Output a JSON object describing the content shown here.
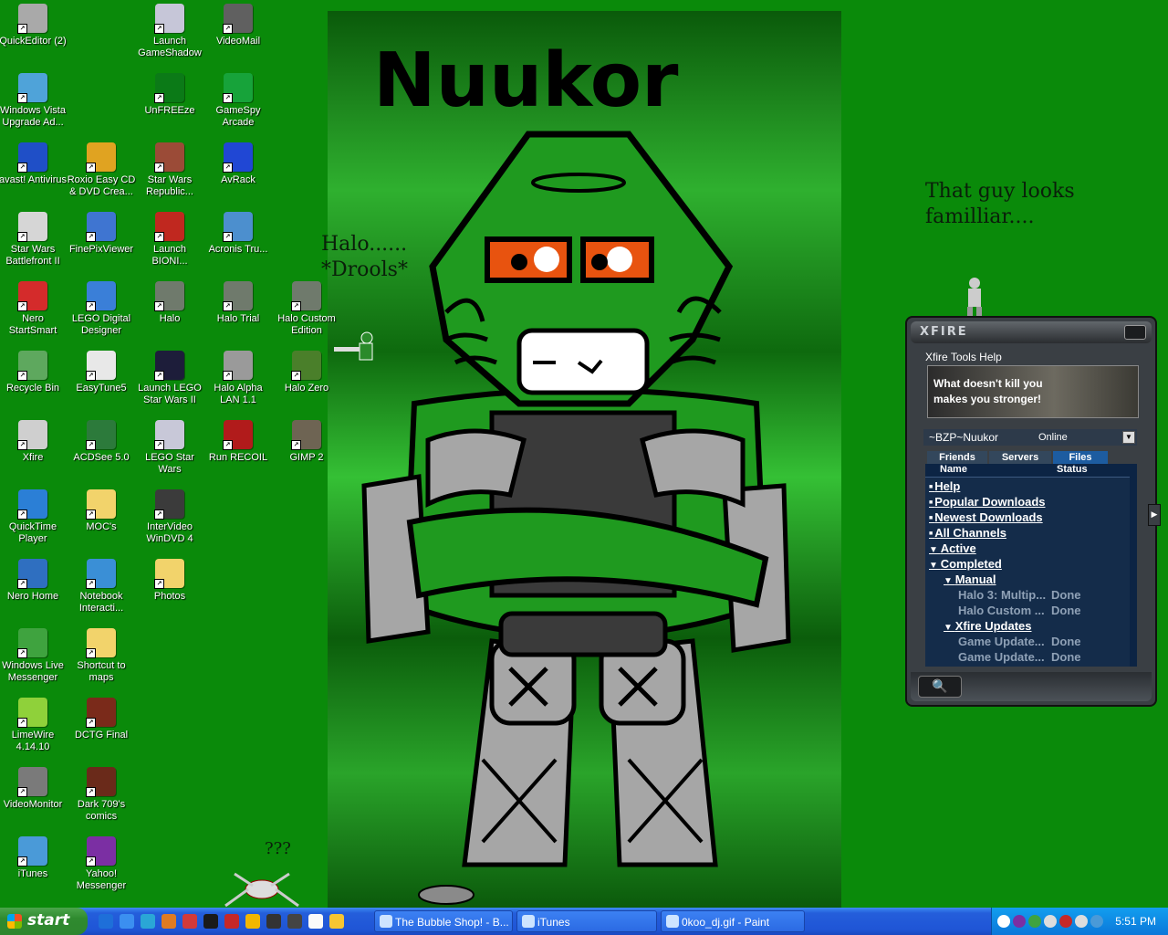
{
  "desktop_icons": [
    {
      "label": "QuickEditor (2)",
      "icon": "editor-icon",
      "color": "#a9a9a9"
    },
    {
      "label": "Launch GameShadow",
      "icon": "gameshadow-icon",
      "color": "#c6c6d8"
    },
    {
      "label": "VideoMail",
      "icon": "videomail-icon",
      "color": "#606060"
    },
    {
      "label": "Windows Vista Upgrade Ad...",
      "icon": "vista-icon",
      "color": "#4fa3d9"
    },
    {
      "label": "UnFREEze",
      "icon": "unfreeze-icon",
      "color": "#0b7a17"
    },
    {
      "label": "GameSpy Arcade",
      "icon": "gamespy-icon",
      "color": "#17a33a"
    },
    {
      "label": "avast! Antivirus",
      "icon": "avast-icon",
      "color": "#1f4fc7"
    },
    {
      "label": "Roxio Easy CD & DVD Crea...",
      "icon": "roxio-icon",
      "color": "#e0a321"
    },
    {
      "label": "Star Wars Republic...",
      "icon": "starwars-republic-icon",
      "color": "#9b4b37"
    },
    {
      "label": "AvRack",
      "icon": "avrack-icon",
      "color": "#2047d4"
    },
    {
      "label": "Star Wars Battlefront II",
      "icon": "battlefront-icon",
      "color": "#d6d6d6"
    },
    {
      "label": "FinePixViewer",
      "icon": "finepix-icon",
      "color": "#3f75d1"
    },
    {
      "label": "Launch BIONI...",
      "icon": "bionicle-icon",
      "color": "#c0281f"
    },
    {
      "label": "Acronis Tru...",
      "icon": "acronis-icon",
      "color": "#4c8fce"
    },
    {
      "label": "Nero StartSmart",
      "icon": "nero-icon",
      "color": "#d42b2b"
    },
    {
      "label": "LEGO Digital Designer",
      "icon": "lego-designer-icon",
      "color": "#3a7fd8"
    },
    {
      "label": "Halo",
      "icon": "halo-icon",
      "color": "#6f7a6c"
    },
    {
      "label": "Halo Trial",
      "icon": "halo-trial-icon",
      "color": "#6f7a6c"
    },
    {
      "label": "Halo Custom Edition",
      "icon": "halo-custom-icon",
      "color": "#6f7a6c"
    },
    {
      "label": "Recycle Bin",
      "icon": "recycle-bin-icon",
      "color": "#5ea85e"
    },
    {
      "label": "EasyTune5",
      "icon": "easytune-icon",
      "color": "#e8e8e8"
    },
    {
      "label": "Launch LEGO Star Wars II",
      "icon": "lego-starwars-icon",
      "color": "#1d1d3a"
    },
    {
      "label": "Halo Alpha LAN 1.1",
      "icon": "halo-alpha-icon",
      "color": "#9a9a9a"
    },
    {
      "label": "Halo Zero",
      "icon": "halo-zero-icon",
      "color": "#4a7f2a"
    },
    {
      "label": "Xfire",
      "icon": "xfire-icon",
      "color": "#cfcfcf"
    },
    {
      "label": "ACDSee 5.0",
      "icon": "acdsee-icon",
      "color": "#2c7a3b"
    },
    {
      "label": "LEGO Star Wars",
      "icon": "lego-sw-icon",
      "color": "#c8c8d8"
    },
    {
      "label": "Run RECOIL",
      "icon": "recoil-icon",
      "color": "#b11b1b"
    },
    {
      "label": "GIMP 2",
      "icon": "gimp-icon",
      "color": "#6e6453"
    },
    {
      "label": "QuickTime Player",
      "icon": "quicktime-icon",
      "color": "#2b7fd6"
    },
    {
      "label": "MOC's",
      "icon": "folder-icon",
      "color": "#f2d36b"
    },
    {
      "label": "InterVideo WinDVD 4",
      "icon": "windvd-icon",
      "color": "#3b3b3b"
    },
    {
      "label": "Nero Home",
      "icon": "nero-home-icon",
      "color": "#2f6fc0"
    },
    {
      "label": "Notebook Interacti...",
      "icon": "notebook-icon",
      "color": "#3a8fd6"
    },
    {
      "label": "Photos",
      "icon": "folder-icon",
      "color": "#f2d36b"
    },
    {
      "label": "Windows Live Messenger",
      "icon": "messenger-icon",
      "color": "#3fa33f"
    },
    {
      "label": "Shortcut to maps",
      "icon": "folder-icon",
      "color": "#f2d36b"
    },
    {
      "label": "LimeWire 4.14.10",
      "icon": "limewire-icon",
      "color": "#8fd13a"
    },
    {
      "label": "DCTG Final",
      "icon": "dctg-icon",
      "color": "#7a2a1a"
    },
    {
      "label": "VideoMonitor",
      "icon": "videomonitor-icon",
      "color": "#7a7a7a"
    },
    {
      "label": "Dark 709's comics",
      "icon": "comics-icon",
      "color": "#6a2a1a"
    },
    {
      "label": "iTunes",
      "icon": "itunes-icon",
      "color": "#4a9ad8"
    },
    {
      "label": "Yahoo! Messenger",
      "icon": "yahoo-icon",
      "color": "#7b2fa3"
    }
  ],
  "wallpaper": {
    "title": "Nuukor",
    "annotation_halo": "Halo......\n*Drools*",
    "annotation_familiar": "That guy looks\nfamilliar....",
    "annotation_question": "???"
  },
  "xfire": {
    "logo": "XFIRE",
    "menu": [
      "Xfire",
      "Tools",
      "Help"
    ],
    "banner": "What doesn't kill you\nmakes you stronger!",
    "username": "~BZP~Nuukor",
    "status": "Online",
    "tabs": [
      "Friends",
      "Servers",
      "Files"
    ],
    "columns": [
      "Name",
      "Status"
    ],
    "rows": [
      {
        "text": "Help",
        "style": "link",
        "indent": 0,
        "marker": "bullet"
      },
      {
        "text": "Popular Downloads",
        "style": "link",
        "indent": 0,
        "marker": "bullet"
      },
      {
        "text": "Newest Downloads",
        "style": "link",
        "indent": 0,
        "marker": "bullet"
      },
      {
        "text": "All Channels",
        "style": "link",
        "indent": 0,
        "marker": "bullet"
      },
      {
        "text": "Active",
        "style": "link",
        "indent": 0,
        "marker": "triangle"
      },
      {
        "text": "Completed",
        "style": "link",
        "indent": 0,
        "marker": "triangle"
      },
      {
        "text": "Manual",
        "style": "link",
        "indent": 1,
        "marker": "triangle"
      },
      {
        "text": "Halo 3: Multip...",
        "style": "dim",
        "indent": 2,
        "marker": "none",
        "status": "Done"
      },
      {
        "text": "Halo Custom ...",
        "style": "dim",
        "indent": 2,
        "marker": "none",
        "status": "Done"
      },
      {
        "text": "Xfire Updates",
        "style": "link",
        "indent": 1,
        "marker": "triangle"
      },
      {
        "text": "Game Update...",
        "style": "dim",
        "indent": 2,
        "marker": "none",
        "status": "Done"
      },
      {
        "text": "Game Update...",
        "style": "dim",
        "indent": 2,
        "marker": "none",
        "status": "Done"
      }
    ]
  },
  "taskbar": {
    "start_label": "start",
    "quick_launch": [
      "windows-icon",
      "ie-icon",
      "network-icon",
      "firefox-icon",
      "nero-icon",
      "msi-icon",
      "lego-icon",
      "outlook-icon",
      "dvd-icon",
      "joystick-icon",
      "paint-icon",
      "messenger-icon"
    ],
    "tasks": [
      {
        "label": "The Bubble Shop! - B...",
        "icon": "ie-icon"
      },
      {
        "label": "iTunes",
        "icon": "itunes-icon"
      },
      {
        "label": "0koo_dj.gif - Paint",
        "icon": "paint-icon"
      }
    ],
    "tray_icons": [
      "back-arrow-icon",
      "yahoo-icon",
      "messenger-icon",
      "network-icon",
      "security-icon",
      "volume-icon",
      "itunes-icon"
    ],
    "clock": "5:51 PM"
  }
}
